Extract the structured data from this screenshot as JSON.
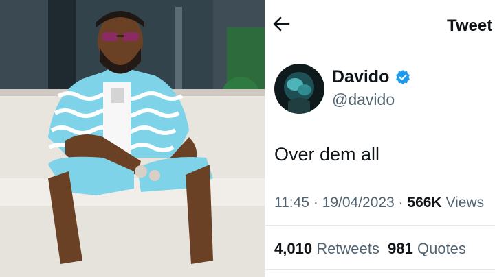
{
  "header": {
    "title": "Tweet"
  },
  "tweet": {
    "author_name": "Davido",
    "author_handle": "@davido",
    "text": "Over dem all",
    "time": "11:45",
    "date": "19/04/2023",
    "views_count": "566K",
    "views_label": "Views",
    "retweets_count": "4,010",
    "retweets_label": "Retweets",
    "quotes_count": "981",
    "quotes_label": "Quotes"
  },
  "colors": {
    "verified": "#1d9bf0",
    "text_primary": "#0f1419",
    "text_secondary": "#536471"
  },
  "icons": {
    "back": "arrow-left-icon",
    "verified": "verified-badge-icon"
  }
}
